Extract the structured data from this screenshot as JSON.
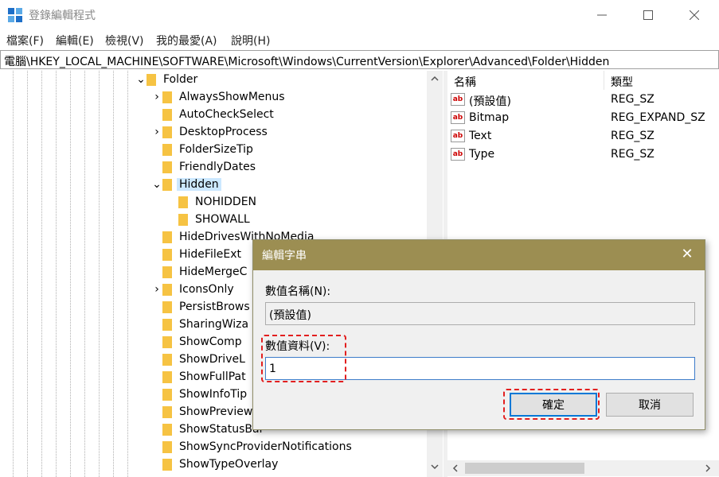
{
  "window": {
    "title": "登錄編輯程式"
  },
  "menu": [
    "檔案(F)",
    "編輯(E)",
    "檢視(V)",
    "我的最愛(A)",
    "說明(H)"
  ],
  "address": "電腦\\HKEY_LOCAL_MACHINE\\SOFTWARE\\Microsoft\\Windows\\CurrentVersion\\Explorer\\Advanced\\Folder\\Hidden",
  "tree": {
    "parent": "Folder",
    "items": [
      "AlwaysShowMenus",
      "AutoCheckSelect",
      "DesktopProcess",
      "FolderSizeTip",
      "FriendlyDates",
      "Hidden",
      "NOHIDDEN",
      "SHOWALL",
      "HideDrivesWithNoMedia",
      "HideFileExt",
      "HideMergeC",
      "IconsOnly",
      "PersistBrows",
      "SharingWiza",
      "ShowComp",
      "ShowDriveL",
      "ShowFullPat",
      "ShowInfoTip",
      "ShowPreview",
      "ShowStatusBar",
      "ShowSyncProviderNotifications",
      "ShowTypeOverlay"
    ],
    "selected": "Hidden"
  },
  "list": {
    "headers": {
      "name": "名稱",
      "type": "類型"
    },
    "rows": [
      {
        "name": "(預設值)",
        "type": "REG_SZ"
      },
      {
        "name": "Bitmap",
        "type": "REG_EXPAND_SZ"
      },
      {
        "name": "Text",
        "type": "REG_SZ"
      },
      {
        "name": "Type",
        "type": "REG_SZ"
      }
    ],
    "icon": "ab"
  },
  "dialog": {
    "title": "編輯字串",
    "name_label": "數值名稱(N):",
    "name_value": "(預設值)",
    "data_label": "數值資料(V):",
    "data_value": "1",
    "ok": "確定",
    "cancel": "取消"
  },
  "colors": {
    "dialog_title": "#9c8e52",
    "highlight": "#e21f1f",
    "selection": "#cce8ff"
  }
}
